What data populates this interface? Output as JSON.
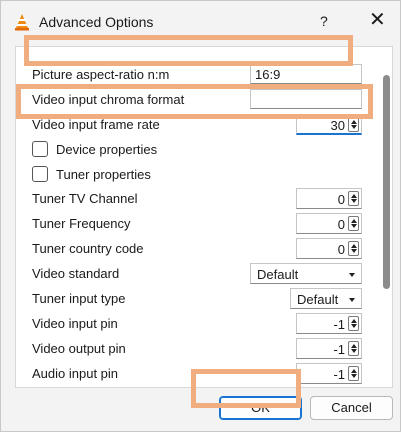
{
  "window": {
    "title": "Advanced Options",
    "help_label": "?",
    "close_label": "✕",
    "app_icon": "vlc-cone-icon"
  },
  "rows": {
    "aspect_ratio": {
      "label": "Picture aspect-ratio n:m",
      "value": "16:9"
    },
    "chroma": {
      "label": "Video input chroma format",
      "value": ""
    },
    "frame_rate": {
      "label": "Video input frame rate",
      "value": "30"
    },
    "device_props": {
      "label": "Device properties",
      "checked": false
    },
    "tuner_props": {
      "label": "Tuner properties",
      "checked": false
    },
    "tv_channel": {
      "label": "Tuner TV Channel",
      "value": "0"
    },
    "tuner_freq": {
      "label": "Tuner Frequency",
      "value": "0"
    },
    "country_code": {
      "label": "Tuner country code",
      "value": "0"
    },
    "video_standard": {
      "label": "Video standard",
      "value": "Default"
    },
    "tuner_input_type": {
      "label": "Tuner input type",
      "value": "Default"
    },
    "video_input_pin": {
      "label": "Video input pin",
      "value": "-1"
    },
    "video_output_pin": {
      "label": "Video output pin",
      "value": "-1"
    },
    "audio_input_pin": {
      "label": "Audio input pin",
      "value": "-1"
    }
  },
  "buttons": {
    "ok": "OK",
    "cancel": "Cancel"
  },
  "colors": {
    "accent": "#1a73d0",
    "highlight": "#f0ad80"
  }
}
